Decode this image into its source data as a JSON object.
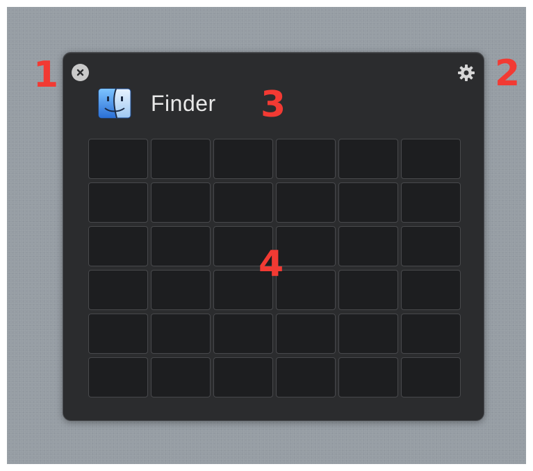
{
  "window": {
    "app_title": "Finder",
    "app_icon": "finder-icon",
    "close_icon": "close-icon",
    "settings_icon": "gear-icon"
  },
  "grid": {
    "rows": 6,
    "columns": 6
  },
  "annotations": {
    "close": "1",
    "settings": "2",
    "title": "3",
    "grid": "4"
  },
  "colors": {
    "annotation_red": "#f23a33",
    "panel_bg": "#2b2c2e",
    "cell_bg": "#1d1e20",
    "backdrop": "#969da4"
  }
}
